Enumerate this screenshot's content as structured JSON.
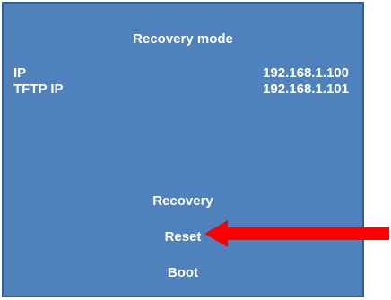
{
  "panel": {
    "title": "Recovery mode",
    "info": [
      {
        "label": "IP",
        "value": "192.168.1.100"
      },
      {
        "label": "TFTP IP",
        "value": "192.168.1.101"
      }
    ],
    "menu": {
      "recovery": "Recovery",
      "reset": "Reset",
      "boot": "Boot"
    }
  },
  "colors": {
    "panel_bg": "#4f81bd",
    "panel_border": "#385d8a",
    "text": "#ffffff",
    "arrow": "#ff0000"
  },
  "annotation": {
    "arrow_icon": "red-left-arrow",
    "points_to": "reset"
  }
}
